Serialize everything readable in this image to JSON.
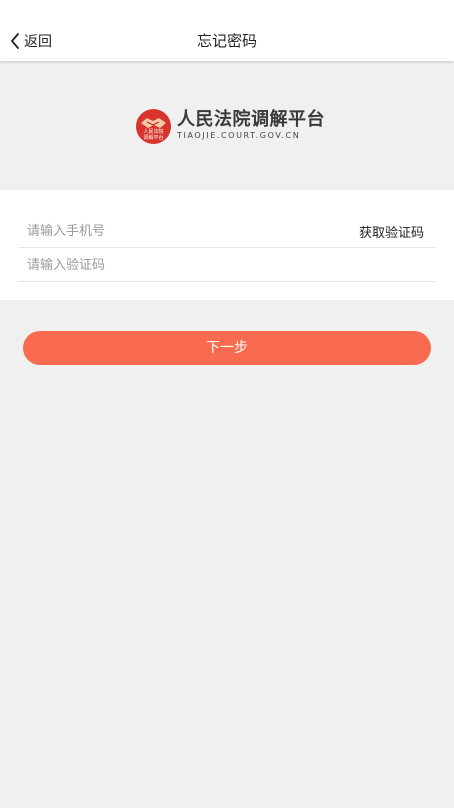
{
  "nav": {
    "back_label": "返回",
    "title": "忘记密码"
  },
  "logo": {
    "name_cn": "人民法院调解平台",
    "domain": "TIAOJIE.COURT.GOV.CN",
    "emblem_text_top": "人民法院",
    "emblem_text_bottom": "调解平台",
    "emblem_color": "#d8342b"
  },
  "form": {
    "phone_placeholder": "请输入手机号",
    "phone_value": "",
    "code_placeholder": "请输入验证码",
    "code_value": "",
    "get_code_label": "获取验证码"
  },
  "actions": {
    "next_label": "下一步",
    "accent_color": "#f96b50"
  }
}
